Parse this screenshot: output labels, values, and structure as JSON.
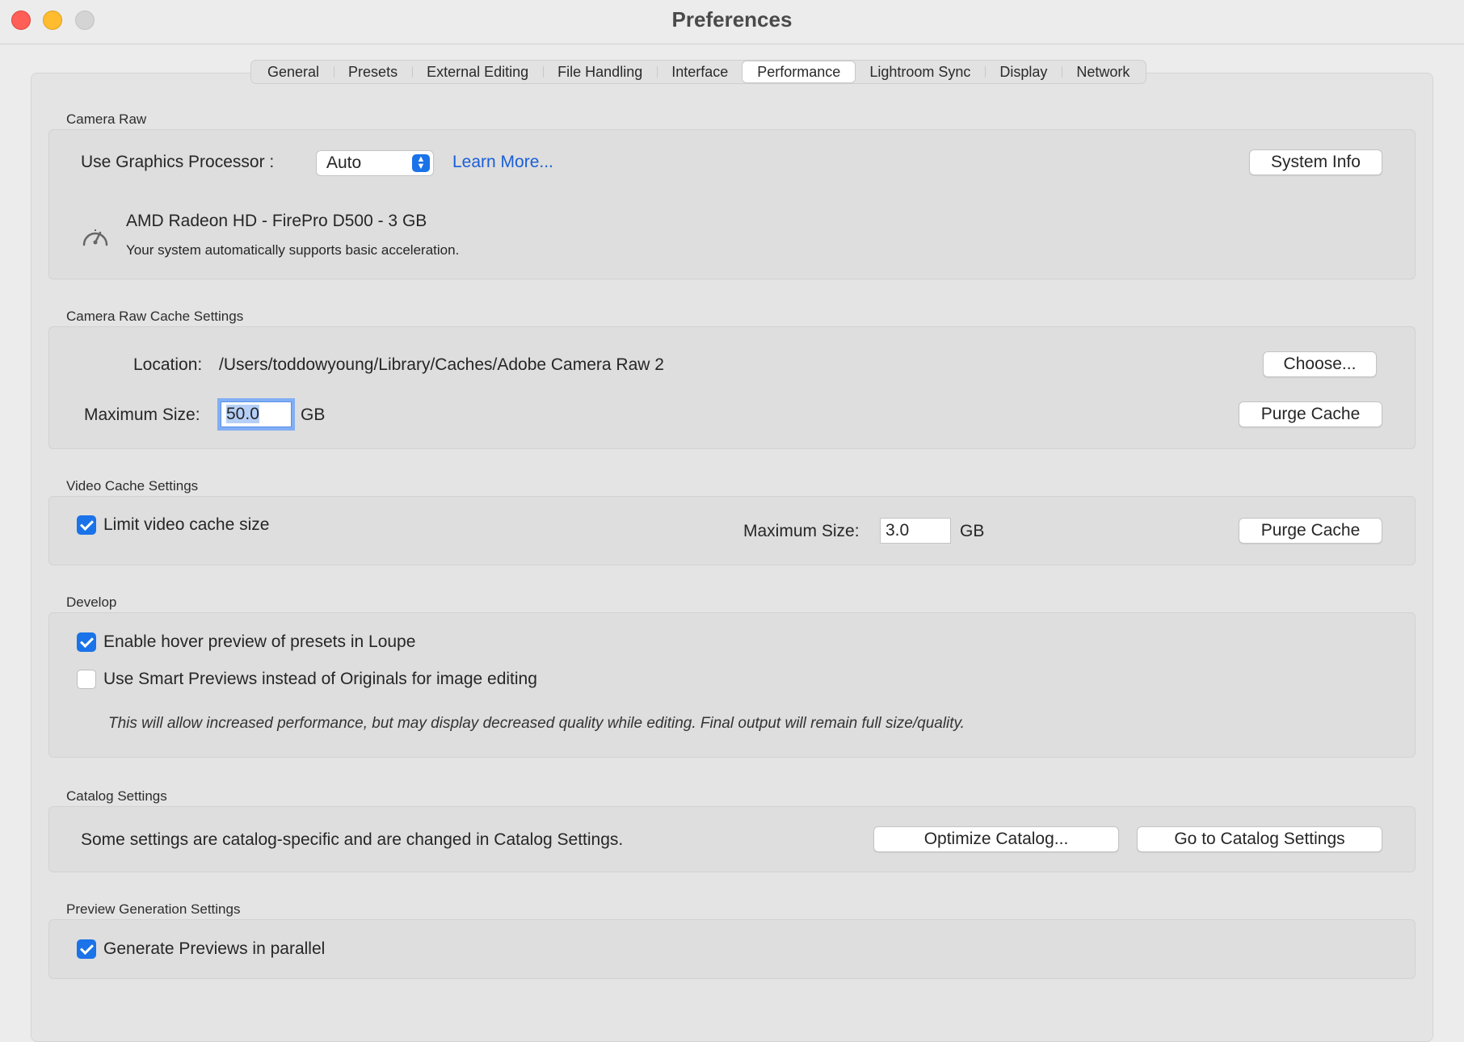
{
  "window": {
    "title": "Preferences"
  },
  "tabs": [
    {
      "label": "General"
    },
    {
      "label": "Presets"
    },
    {
      "label": "External Editing"
    },
    {
      "label": "File Handling"
    },
    {
      "label": "Interface"
    },
    {
      "label": "Performance",
      "active": true
    },
    {
      "label": "Lightroom Sync"
    },
    {
      "label": "Display"
    },
    {
      "label": "Network"
    }
  ],
  "camera_raw": {
    "section": "Camera Raw",
    "gpu_label": "Use Graphics Processor :",
    "gpu_value": "Auto",
    "learn_more": "Learn More...",
    "system_info": "System Info",
    "gpu_name": "AMD Radeon HD - FirePro D500 - 3 GB",
    "gpu_status": "Your system automatically supports basic acceleration.",
    "gauge_icon": "speedometer-icon"
  },
  "cache": {
    "section": "Camera Raw Cache Settings",
    "location_label": "Location:",
    "location_value": "/Users/toddowyoung/Library/Caches/Adobe Camera Raw 2",
    "choose": "Choose...",
    "max_size_label": "Maximum Size:",
    "max_size_value": "50.0",
    "unit": "GB",
    "purge": "Purge Cache"
  },
  "video_cache": {
    "section": "Video Cache Settings",
    "limit_label": "Limit video cache size",
    "limit_checked": true,
    "max_size_label": "Maximum Size:",
    "max_size_value": "3.0",
    "unit": "GB",
    "purge": "Purge Cache"
  },
  "develop": {
    "section": "Develop",
    "hover_label": "Enable hover preview of presets in Loupe",
    "hover_checked": true,
    "smart_label": "Use Smart Previews instead of Originals for image editing",
    "smart_checked": false,
    "note": "This will allow increased performance, but may display decreased quality while editing. Final output will remain full size/quality."
  },
  "catalog": {
    "section": "Catalog Settings",
    "text": "Some settings are catalog-specific and are changed in Catalog Settings.",
    "optimize": "Optimize Catalog...",
    "goto": "Go to Catalog Settings"
  },
  "preview": {
    "section": "Preview Generation Settings",
    "parallel_label": "Generate Previews in parallel",
    "parallel_checked": true
  },
  "colors": {
    "accent": "#1a73e8",
    "link": "#1a5fd6",
    "close": "#ff5f57",
    "minimize": "#febc2e"
  }
}
